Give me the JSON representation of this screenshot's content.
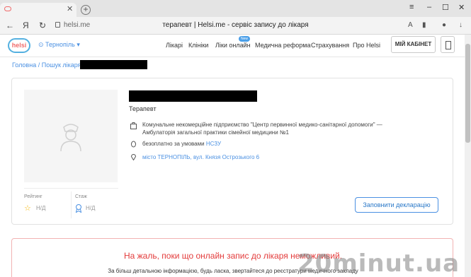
{
  "browser": {
    "tab_title": "",
    "url": "helsi.me",
    "page_title": "терапевт | Helsi.me - сервіс запису до лікаря",
    "yandex_logo": "Я"
  },
  "header": {
    "logo_text": "helsi",
    "city": "Тернопіль",
    "menu": [
      "Лікарі",
      "Клініки",
      "Ліки онлайн",
      "Медична реформа",
      "Страхування",
      "Про Helsi"
    ],
    "new_badge": "New",
    "cabinet_label": "МІЙ КАБІНЕТ"
  },
  "breadcrumb": {
    "items": [
      "Головна",
      "Пошук лікаря"
    ],
    "separator": "/"
  },
  "doctor": {
    "specialty": "Терапевт",
    "clinic_line1": "Комунальне некомерційне підприємство \"Центр первинної медико-санітарної допомоги\" —",
    "clinic_line2": "Амбулаторія загальної практики сімейної медицини №1",
    "payment_text": "безоплатно за умовами",
    "payment_link": "НСЗУ",
    "address": "місто ТЕРНОПІЛЬ, вул. Князя Острозького 6",
    "rating_label": "Рейтинг",
    "rating_value": "Н/Д",
    "experience_label": "Стаж",
    "experience_value": "Н/Д",
    "declare_button": "Заповнити декларацію"
  },
  "notice": {
    "title": "На жаль, поки що онлайн запис до лікаря неможливий.",
    "text": "За більш детальною інформацією, будь ласка, звертайтеся до реєстратури медичного закладу"
  },
  "watermark": "20minut.ua",
  "colors": {
    "accent": "#4a90e2",
    "error": "#e33b3b",
    "logo_blue": "#54b0e0",
    "logo_red": "#f06a6a"
  }
}
